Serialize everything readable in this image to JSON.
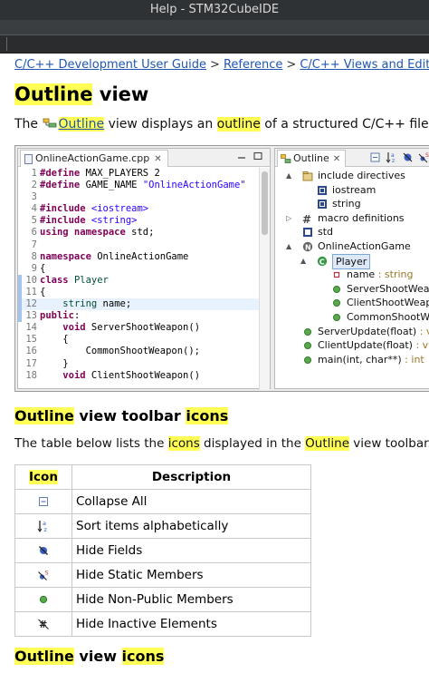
{
  "window": {
    "title": "Help - STM32CubeIDE"
  },
  "breadcrumb": {
    "items": [
      "C/C++ Development User Guide",
      "Reference",
      "C/C++ Views and Editors"
    ],
    "separator": ">"
  },
  "heading": {
    "highlight": "Outline",
    "rest": " view"
  },
  "intro": {
    "prefix": "The ",
    "link": "Outline",
    "middle": " view displays an ",
    "highlight": "outline",
    "suffix": " of a structured C/C++ file that is cu"
  },
  "editor": {
    "tab_label": "OnlineActionGame.cpp",
    "lines": [
      {
        "n": "1",
        "html": "<span class='kw'>#define</span> MAX_PLAYERS 2"
      },
      {
        "n": "2",
        "html": "<span class='kw'>#define</span> GAME_NAME <span class='str'>\"OnlineActionGame\"</span>"
      },
      {
        "n": "3",
        "html": ""
      },
      {
        "n": "4",
        "html": "<span class='kw'>#include</span> <span class='str'>&lt;iostream&gt;</span>"
      },
      {
        "n": "5",
        "html": "<span class='kw'>#include</span> <span class='str'>&lt;string&gt;</span>"
      },
      {
        "n": "6",
        "html": "<span class='kw'>using namespace</span> std;"
      },
      {
        "n": "7",
        "html": ""
      },
      {
        "n": "8",
        "html": "<span class='kw'>namespace</span> OnlineActionGame"
      },
      {
        "n": "9",
        "html": "{"
      },
      {
        "n": "10",
        "html": "<span class='kw'>class</span> <span class='cls'>Player</span>"
      },
      {
        "n": "11",
        "html": "{"
      },
      {
        "n": "12",
        "html": "    <span class='cls'>string</span> name;"
      },
      {
        "n": "13",
        "html": "<span class='kw'>public</span>:"
      },
      {
        "n": "14",
        "html": "    <span class='kw'>void</span> ServerShootWeapon()"
      },
      {
        "n": "15",
        "html": "    {"
      },
      {
        "n": "16",
        "html": "        CommonShootWeapon();"
      },
      {
        "n": "17",
        "html": "    }"
      },
      {
        "n": "18",
        "html": "    <span class='kw'>void</span> ClientShootWeapon()"
      }
    ]
  },
  "outline": {
    "tab_label": "Outline",
    "nodes": [
      {
        "label": "include directives",
        "type": "",
        "arrow": "▲",
        "icon": "include-folder"
      },
      {
        "label": "iostream",
        "type": "",
        "arrow": "",
        "icon": "include"
      },
      {
        "label": "string",
        "type": "",
        "arrow": "",
        "icon": "include"
      },
      {
        "label": "macro definitions",
        "type": "",
        "arrow": "▷",
        "icon": "macro"
      },
      {
        "label": "std",
        "type": "",
        "arrow": "",
        "icon": "using"
      },
      {
        "label": "OnlineActionGame",
        "type": "",
        "arrow": "▲",
        "icon": "namespace"
      },
      {
        "label": "Player",
        "type": "",
        "arrow": "▲",
        "icon": "class"
      },
      {
        "label": "name",
        "type": " : string",
        "arrow": "",
        "icon": "field"
      },
      {
        "label": "ServerShootWeap",
        "type": "",
        "arrow": "",
        "icon": "method"
      },
      {
        "label": "ClientShootWeap",
        "type": "",
        "arrow": "",
        "icon": "method"
      },
      {
        "label": "CommonShootW",
        "type": "",
        "arrow": "",
        "icon": "method"
      },
      {
        "label": "ServerUpdate(float)",
        "type": " : void",
        "arrow": "",
        "icon": "function"
      },
      {
        "label": "ClientUpdate(float)",
        "type": " : void",
        "arrow": "",
        "icon": "function"
      },
      {
        "label": "main(int, char**)",
        "type": " : int",
        "arrow": "",
        "icon": "function"
      }
    ]
  },
  "section_toolbar": {
    "hl1": "Outline",
    "mid": " view toolbar ",
    "hl2": "icons"
  },
  "table_intro": {
    "prefix": "The table below lists the ",
    "hl1": "icons",
    "mid": " displayed in the ",
    "hl2": "Outline",
    "suffix": " view toolbar."
  },
  "icon_table": {
    "headers": {
      "icon": "Icon",
      "description": "Description"
    },
    "rows": [
      {
        "icon": "collapse-all-icon",
        "description": "Collapse All"
      },
      {
        "icon": "sort-alpha-icon",
        "description": "Sort items alphabetically"
      },
      {
        "icon": "hide-fields-icon",
        "description": "Hide Fields"
      },
      {
        "icon": "hide-static-icon",
        "description": "Hide Static Members"
      },
      {
        "icon": "hide-nonpublic-icon",
        "description": "Hide Non-Public Members"
      },
      {
        "icon": "hide-inactive-icon",
        "description": "Hide Inactive Elements"
      }
    ]
  },
  "section_icons": {
    "hl1": "Outline",
    "mid": " view ",
    "hl2": "icons"
  },
  "colors": {
    "highlight": "#ffff55",
    "link": "#1f56b0",
    "titlebar": "#2f3234"
  }
}
